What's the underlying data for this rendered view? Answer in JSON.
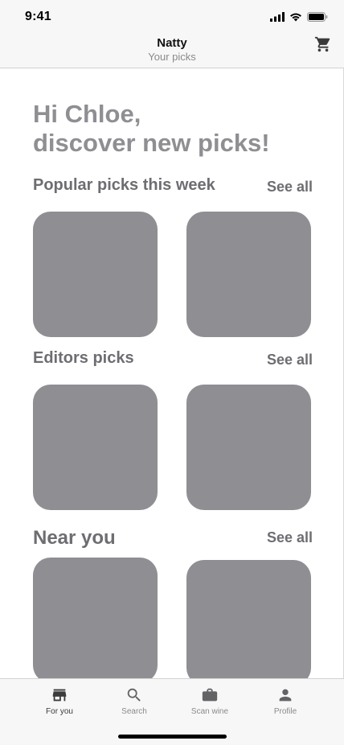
{
  "status_bar": {
    "time": "9:41"
  },
  "header": {
    "title": "Natty",
    "subtitle": "Your picks",
    "cart_icon": "cart-icon"
  },
  "greeting": {
    "line1": "Hi Chloe,",
    "line2": "discover new picks!"
  },
  "sections": [
    {
      "title": "Popular picks this week",
      "see_all": "See all",
      "cards": 2
    },
    {
      "title": "Editors picks",
      "see_all": "See all",
      "cards": 2
    },
    {
      "title": "Near you",
      "see_all": "See all",
      "cards": 2
    }
  ],
  "tabs": [
    {
      "label": "For you",
      "icon": "storefront-icon",
      "active": true
    },
    {
      "label": "Search",
      "icon": "search-icon",
      "active": false
    },
    {
      "label": "Scan wine",
      "icon": "briefcase-icon",
      "active": false
    },
    {
      "label": "Profile",
      "icon": "person-icon",
      "active": false
    }
  ],
  "colors": {
    "card_placeholder": "#8e8e93",
    "heading_gray": "#8e8e93",
    "section_gray": "#6d6d72",
    "bar_background": "#f7f7f7"
  }
}
